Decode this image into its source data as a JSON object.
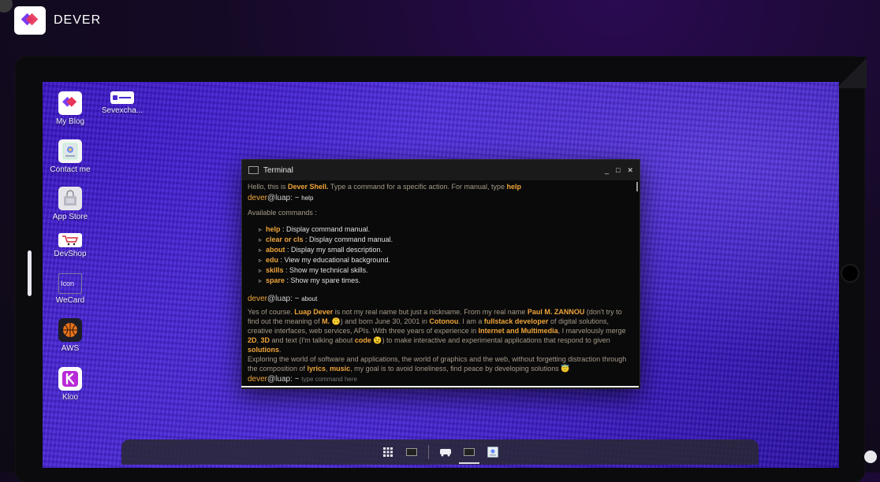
{
  "brand": {
    "name": "DEVER",
    "colors": {
      "primary": "#e8355a",
      "secondary": "#7b3cf0"
    }
  },
  "desktop": {
    "icons": [
      {
        "label": "My Blog",
        "icon": "blog-logo-icon"
      },
      {
        "label": "Sevexcha...",
        "icon": "sevexchange-icon"
      },
      {
        "label": "Contact me",
        "icon": "contact-icon"
      },
      {
        "label": "App Store",
        "icon": "app-store-icon"
      },
      {
        "label": "DevShop",
        "icon": "devshop-icon"
      },
      {
        "label": "WeCard",
        "icon": "wecard-icon",
        "broken_alt": "Icon"
      },
      {
        "label": "AWS",
        "icon": "aws-basketball-icon"
      },
      {
        "label": "Kloo",
        "icon": "kloo-icon"
      }
    ]
  },
  "terminal": {
    "title": "Terminal",
    "controls": {
      "minimize": "_",
      "maximize": "□",
      "close": "✕"
    },
    "intro": {
      "pre": "Hello, this is ",
      "hl1": "Dever Shell.",
      "mid": " Type a command for a specific action. For manual, type ",
      "hl2": "help"
    },
    "prompt": {
      "user": "dever",
      "host": "@luap:",
      "tilde": " ~ "
    },
    "cmd1": "help",
    "available": "Available commands :",
    "commands": [
      {
        "name": "help",
        "desc": " : Display command manual."
      },
      {
        "name": "clear or cls",
        "desc": " : Display command manual."
      },
      {
        "name": "about",
        "desc": " : Display my small description."
      },
      {
        "name": "edu",
        "desc": " : View my educational background."
      },
      {
        "name": "skills",
        "desc": " : Show my technical skills."
      },
      {
        "name": "spare",
        "desc": " : Show my spare times."
      }
    ],
    "cmd2": "about",
    "about": {
      "p1": "Yes of course. ",
      "h1": "Luap Dever",
      "p2": " is not my real name but just a nickname. From my real name ",
      "h2": "Paul M. ZANNOU",
      "p3": " (don't try to find out the meaning of ",
      "h3": "M.",
      "e1": " 🙃",
      "p4": ") and born June 30, 2001 in ",
      "h4": "Cotonou",
      "p5": ". I am a ",
      "h5": "fullstack developer",
      "p6": " of digital solutions, creative interfaces, web services, APIs. With three years of experience in ",
      "h6": "Internet and Multimedia",
      "p7": ", I marvelously merge ",
      "h7": "2D",
      "p8": ", ",
      "h8": "3D",
      "p9": " and text (I'm talking about ",
      "h9": "code",
      "e2": " 😉",
      "p10": ") to make interactive and experimental applications that respond to given ",
      "h10": "solutions",
      "p11": ".",
      "p12": "Exploring the world of software and applications, the world of graphics and the web, without forgetting distraction through the composition of ",
      "h11": "lyrics",
      "p13": ", ",
      "h12": "music",
      "p14": ", my goal is to avoid loneliness, find peace by developing solutions",
      "e3": " 😇"
    },
    "input_placeholder": "type command here"
  },
  "dock": {
    "items": [
      {
        "icon": "app-grid-icon"
      },
      {
        "icon": "terminal-icon"
      },
      {
        "icon": "devshop-icon"
      },
      {
        "icon": "terminal-icon",
        "active": true
      },
      {
        "icon": "contact-icon"
      }
    ]
  }
}
